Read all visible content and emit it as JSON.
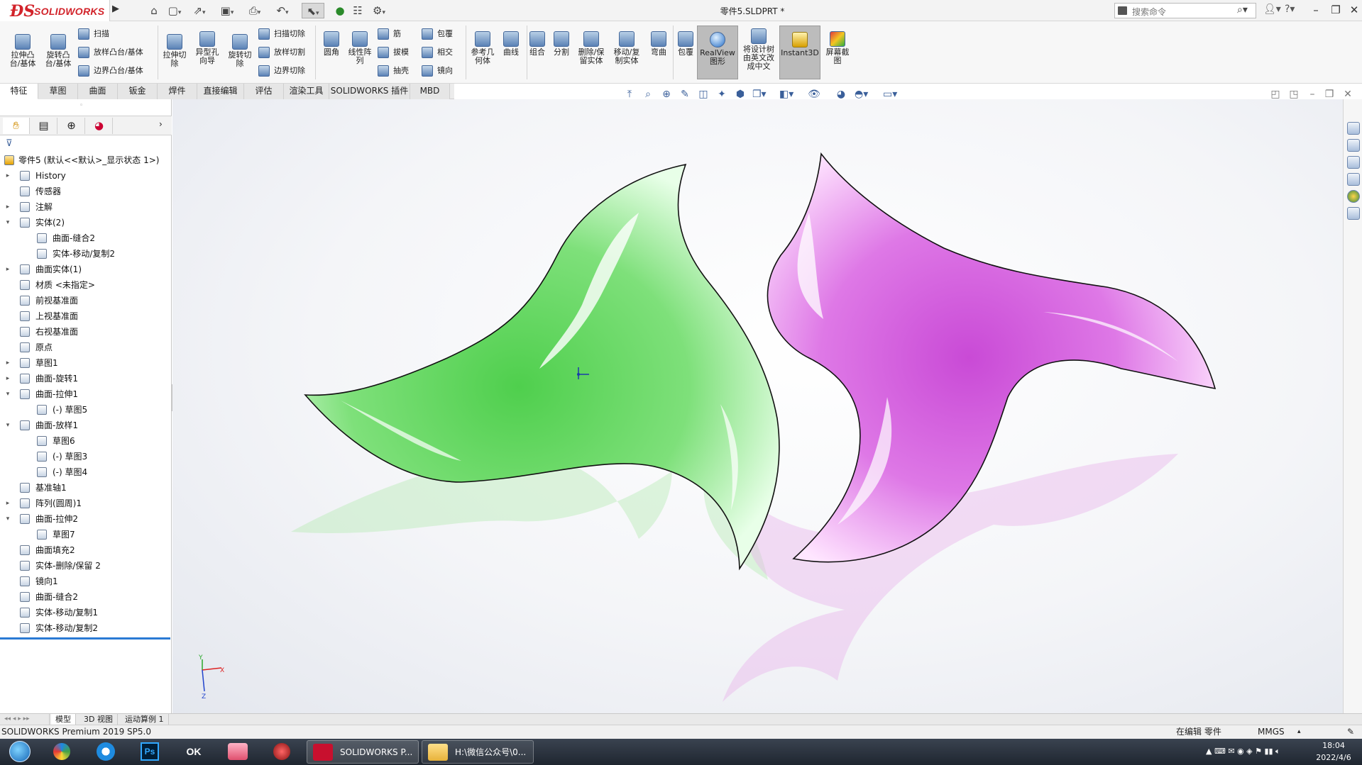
{
  "window": {
    "doc_title": "零件5.SLDPRT *",
    "search_placeholder": "搜索命令"
  },
  "app": {
    "logo_text": "SOLIDWORKS"
  },
  "ribbon": {
    "big_buttons": [
      {
        "id": "extrude-boss",
        "label": "拉伸凸\n台/基体"
      },
      {
        "id": "revolve-boss",
        "label": "旋转凸\n台/基体"
      },
      {
        "id": "extrude-cut",
        "label": "拉伸切\n除"
      },
      {
        "id": "hole-wizard",
        "label": "异型孔\n向导"
      },
      {
        "id": "revolve-cut",
        "label": "旋转切\n除"
      },
      {
        "id": "fillet",
        "label": "圆角"
      },
      {
        "id": "linear-pattern",
        "label": "线性阵\n列"
      },
      {
        "id": "ref-geometry",
        "label": "参考几\n何体"
      },
      {
        "id": "curves",
        "label": "曲线"
      },
      {
        "id": "combine",
        "label": "组合"
      },
      {
        "id": "split",
        "label": "分割"
      },
      {
        "id": "delete-keep",
        "label": "删除/保\n留实体"
      },
      {
        "id": "move-copy",
        "label": "移动/复\n制实体"
      },
      {
        "id": "flex",
        "label": "弯曲"
      },
      {
        "id": "wrap2",
        "label": "包覆"
      },
      {
        "id": "realview",
        "label": "RealView\n图形"
      },
      {
        "id": "translate-tree",
        "label": "将设计树\n由英文改\n成中文"
      },
      {
        "id": "instant3d",
        "label": "Instant3D"
      },
      {
        "id": "screenshot",
        "label": "屏幕截\n图"
      }
    ],
    "small_buttons": [
      {
        "id": "sweep",
        "label": "扫描"
      },
      {
        "id": "loft",
        "label": "放样凸台/基体"
      },
      {
        "id": "boundary",
        "label": "边界凸台/基体"
      },
      {
        "id": "swept-cut",
        "label": "扫描切除"
      },
      {
        "id": "lofted-cut",
        "label": "放样切割"
      },
      {
        "id": "boundary-cut",
        "label": "边界切除"
      },
      {
        "id": "rib",
        "label": "筋"
      },
      {
        "id": "draft",
        "label": "拔模"
      },
      {
        "id": "shell",
        "label": "抽壳"
      },
      {
        "id": "wrap",
        "label": "包覆"
      },
      {
        "id": "intersect",
        "label": "相交"
      },
      {
        "id": "mirror",
        "label": "镜向"
      }
    ]
  },
  "tabs": [
    "特征",
    "草图",
    "曲面",
    "钣金",
    "焊件",
    "直接编辑",
    "评估",
    "渲染工具",
    "SOLIDWORKS 插件",
    "MBD"
  ],
  "tree": {
    "root": "零件5  (默认<<默认>_显示状态 1>)",
    "items": [
      {
        "label": "History",
        "level": 1,
        "exp": "▸"
      },
      {
        "label": "传感器",
        "level": 1,
        "exp": ""
      },
      {
        "label": "注解",
        "level": 1,
        "exp": "▸"
      },
      {
        "label": "实体(2)",
        "level": 1,
        "exp": "▾"
      },
      {
        "label": "曲面-缝合2",
        "level": 2,
        "exp": ""
      },
      {
        "label": "实体-移动/复制2",
        "level": 2,
        "exp": ""
      },
      {
        "label": "曲面实体(1)",
        "level": 1,
        "exp": "▸"
      },
      {
        "label": "材质 <未指定>",
        "level": 1,
        "exp": ""
      },
      {
        "label": "前视基准面",
        "level": 1,
        "exp": ""
      },
      {
        "label": "上视基准面",
        "level": 1,
        "exp": ""
      },
      {
        "label": "右视基准面",
        "level": 1,
        "exp": ""
      },
      {
        "label": "原点",
        "level": 1,
        "exp": ""
      },
      {
        "label": "草图1",
        "level": 1,
        "exp": "▸"
      },
      {
        "label": "曲面-旋转1",
        "level": 1,
        "exp": "▸"
      },
      {
        "label": "曲面-拉伸1",
        "level": 1,
        "exp": "▾"
      },
      {
        "label": "(-) 草图5",
        "level": 2,
        "exp": ""
      },
      {
        "label": "曲面-放样1",
        "level": 1,
        "exp": "▾"
      },
      {
        "label": "草图6",
        "level": 2,
        "exp": ""
      },
      {
        "label": "(-) 草图3",
        "level": 2,
        "exp": ""
      },
      {
        "label": "(-) 草图4",
        "level": 2,
        "exp": ""
      },
      {
        "label": "基准轴1",
        "level": 1,
        "exp": ""
      },
      {
        "label": "阵列(圆周)1",
        "level": 1,
        "exp": "▸"
      },
      {
        "label": "曲面-拉伸2",
        "level": 1,
        "exp": "▾"
      },
      {
        "label": "草图7",
        "level": 2,
        "exp": ""
      },
      {
        "label": "曲面填充2",
        "level": 1,
        "exp": ""
      },
      {
        "label": "实体-删除/保留 2",
        "level": 1,
        "exp": ""
      },
      {
        "label": "镜向1",
        "level": 1,
        "exp": ""
      },
      {
        "label": "曲面-缝合2",
        "level": 1,
        "exp": ""
      },
      {
        "label": "实体-移动/复制1",
        "level": 1,
        "exp": ""
      },
      {
        "label": "实体-移动/复制2",
        "level": 1,
        "exp": ""
      }
    ]
  },
  "bottom_tabs": [
    "模型",
    "3D 视图",
    "运动算例 1"
  ],
  "status": {
    "left": "SOLIDWORKS Premium 2019 SP5.0",
    "mode": "在编辑 零件",
    "units": "MMGS"
  },
  "taskbar": {
    "app1": "SOLIDWORKS P...",
    "app2": "H:\\微信公众号\\0...",
    "time": "18:04",
    "date": "2022/4/6"
  },
  "colors": {
    "green_body": "#6ee06a",
    "pink_body": "#e070e0",
    "accent_red": "#d2232a"
  }
}
